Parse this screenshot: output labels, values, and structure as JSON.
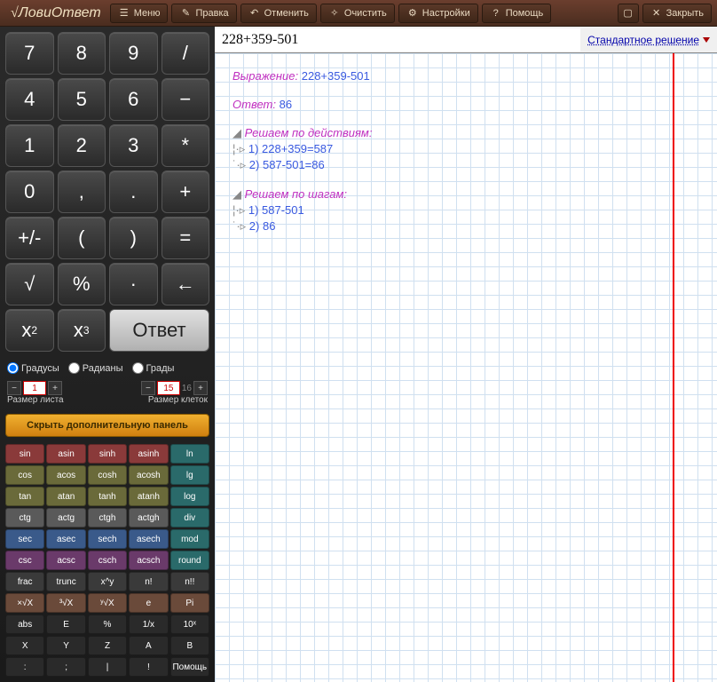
{
  "app": {
    "title": "ЛовиОтвет"
  },
  "toolbar": {
    "menu": "Меню",
    "edit": "Правка",
    "undo": "Отменить",
    "clear": "Очистить",
    "settings": "Настройки",
    "help": "Помощь",
    "close": "Закрыть"
  },
  "keypad": {
    "k7": "7",
    "k8": "8",
    "k9": "9",
    "div": "/",
    "k4": "4",
    "k5": "5",
    "k6": "6",
    "minus": "−",
    "k1": "1",
    "k2": "2",
    "k3": "3",
    "mul": "*",
    "k0": "0",
    "comma": ",",
    "dot": ".",
    "plus": "+",
    "pm": "+/-",
    "lp": "(",
    "rp": ")",
    "eq": "=",
    "sqrt": "√",
    "pct": "%",
    "exp": "·",
    "back": "←",
    "sq": "x",
    "sq_sup": "2",
    "cu": "x",
    "cu_sup": "3",
    "answer": "Ответ"
  },
  "angles": {
    "deg": "Градусы",
    "rad": "Радианы",
    "grad": "Грады"
  },
  "spins": {
    "sheet_value": "1",
    "sheet_label": "Размер листа",
    "cell_value": "15",
    "cell_extra": "16",
    "cell_label": "Размер клеток"
  },
  "toggle_panel": "Скрыть дополнительную панель",
  "funcs": [
    [
      "sin",
      "asin",
      "sinh",
      "asinh",
      "ln"
    ],
    [
      "cos",
      "acos",
      "cosh",
      "acosh",
      "lg"
    ],
    [
      "tan",
      "atan",
      "tanh",
      "atanh",
      "log"
    ],
    [
      "ctg",
      "actg",
      "ctgh",
      "actgh",
      "div"
    ],
    [
      "sec",
      "asec",
      "sech",
      "asech",
      "mod"
    ],
    [
      "csc",
      "acsc",
      "csch",
      "acsch",
      "round"
    ],
    [
      "frac",
      "trunc",
      "x^y",
      "n!",
      "n!!"
    ],
    [
      "×√X",
      "³√X",
      "ʸ√X",
      "e",
      "Pi"
    ],
    [
      "abs",
      "E",
      "%",
      "1/x",
      "10ˣ"
    ],
    [
      "X",
      "Y",
      "Z",
      "A",
      "B"
    ],
    [
      ":",
      ";",
      "|",
      "!",
      "Помощь"
    ]
  ],
  "func_colors": [
    [
      "c-red",
      "c-red",
      "c-red",
      "c-red",
      "c-teal"
    ],
    [
      "c-olive",
      "c-olive",
      "c-olive",
      "c-olive",
      "c-teal"
    ],
    [
      "c-olive",
      "c-olive",
      "c-olive",
      "c-olive",
      "c-teal"
    ],
    [
      "c-grey",
      "c-grey",
      "c-grey",
      "c-grey",
      "c-teal"
    ],
    [
      "c-blue",
      "c-blue",
      "c-blue",
      "c-blue",
      "c-teal"
    ],
    [
      "c-purple",
      "c-purple",
      "c-purple",
      "c-purple",
      "c-teal"
    ],
    [
      "c-dgrey",
      "c-dgrey",
      "c-dgrey",
      "c-dgrey",
      "c-dgrey"
    ],
    [
      "c-brown",
      "c-brown",
      "c-brown",
      "c-brown",
      "c-brown"
    ],
    [
      "c-dark",
      "c-dark",
      "c-dark",
      "c-dark",
      "c-dark"
    ],
    [
      "c-dark",
      "c-dark",
      "c-dark",
      "c-dark",
      "c-dark"
    ],
    [
      "c-dark",
      "c-dark",
      "c-dark",
      "c-dark",
      "c-dark"
    ]
  ],
  "formula": "228+359-501",
  "solution_type": "Стандартное решение",
  "worksheet": {
    "expr_label": "Выражение:",
    "expr": "228+359-501",
    "answer_label": "Ответ:",
    "answer": "86",
    "by_actions": "Решаем по действиям:",
    "a1": "1) 228+359=587",
    "a2": "2) 587-501=86",
    "by_steps": "Решаем по шагам:",
    "s1": "1) 587-501",
    "s2": "2) 86"
  }
}
